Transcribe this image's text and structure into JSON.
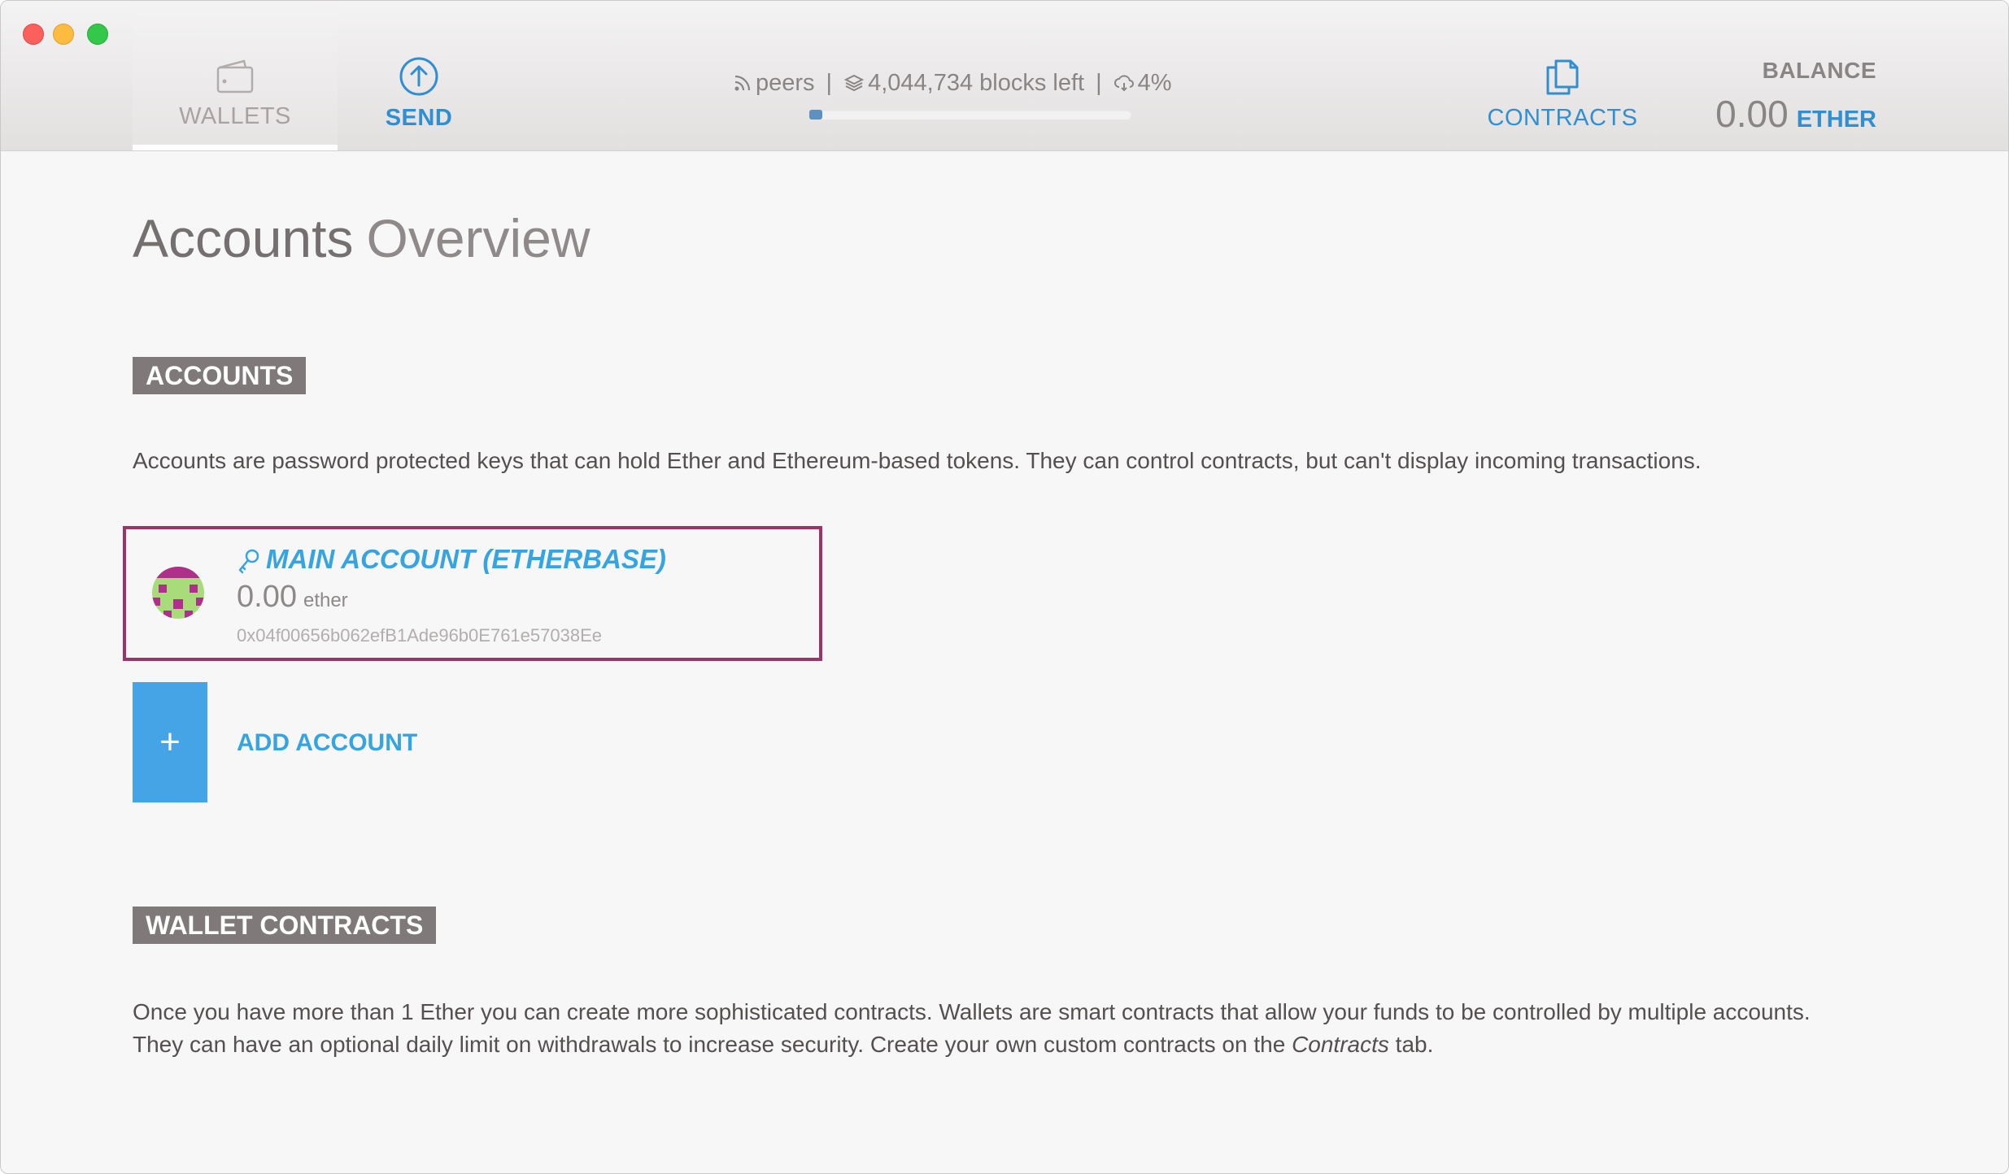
{
  "window": {
    "controls": [
      "close",
      "minimize",
      "zoom"
    ]
  },
  "nav": {
    "wallets": {
      "label": "WALLETS",
      "icon": "wallet-icon",
      "active": true
    },
    "send": {
      "label": "SEND",
      "icon": "send-arrow-icon"
    },
    "contracts": {
      "label": "CONTRACTS",
      "icon": "contracts-icon"
    }
  },
  "status": {
    "peers": "peers",
    "blocks_left": "4,044,734 blocks left",
    "sync_percent": "4%",
    "sync_progress": 0.04
  },
  "balance": {
    "label": "BALANCE",
    "value": "0.00",
    "unit": "ETHER"
  },
  "page": {
    "title_strong": "Accounts",
    "title_light": "Overview"
  },
  "accounts_section": {
    "heading": "ACCOUNTS",
    "description": "Accounts are password protected keys that can hold Ether and Ethereum-based tokens. They can control contracts, but can't display incoming transactions."
  },
  "accounts": [
    {
      "name": "MAIN ACCOUNT (ETHERBASE)",
      "balance": "0.00",
      "unit": "ether",
      "address": "0x04f00656b062efB1Ade96b0E761e57038Ee"
    }
  ],
  "add_account": {
    "icon": "+",
    "label": "ADD ACCOUNT"
  },
  "wallet_contracts_section": {
    "heading": "WALLET CONTRACTS",
    "description_line1": "Once you have more than 1 Ether you can create more sophisticated contracts. Wallets are smart contracts that allow your funds to be controlled by multiple accounts.",
    "description_line2_pre": "They can have an optional daily limit on withdrawals to increase security. Create your own custom contracts on the ",
    "description_line2_em": "Contracts",
    "description_line2_post": " tab."
  },
  "colors": {
    "accent_blue": "#2f8fd0",
    "badge_gray": "#7f7979",
    "highlight_border": "#9a3566",
    "add_button": "#45a4e6"
  }
}
